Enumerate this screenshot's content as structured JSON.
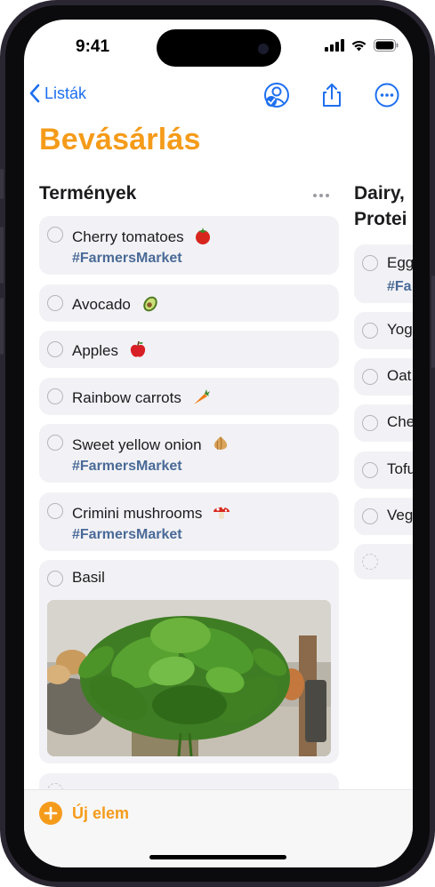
{
  "status_bar": {
    "time": "9:41"
  },
  "nav": {
    "back_label": "Listák"
  },
  "page": {
    "title": "Bevásárlás"
  },
  "columns": [
    {
      "header": "Termények",
      "items": [
        {
          "text": "Cherry tomatoes",
          "emoji": "tomato-icon",
          "tag": "#FarmersMarket"
        },
        {
          "text": "Avocado",
          "emoji": "avocado-icon",
          "tag": ""
        },
        {
          "text": "Apples",
          "emoji": "apple-icon",
          "tag": ""
        },
        {
          "text": "Rainbow carrots",
          "emoji": "carrot-icon",
          "tag": ""
        },
        {
          "text": "Sweet yellow onion",
          "emoji": "onion-icon",
          "tag": "#FarmersMarket"
        },
        {
          "text": "Crimini mushrooms",
          "emoji": "mushroom-icon",
          "tag": "#FarmersMarket"
        },
        {
          "text": "Basil",
          "emoji": "",
          "tag": "",
          "image": "basil-photo"
        }
      ]
    },
    {
      "header_line1": "Dairy,",
      "header_line2": "Protei",
      "items": [
        {
          "text": "Egg",
          "tag": "#Fa"
        },
        {
          "text": "Yog"
        },
        {
          "text": "Oat"
        },
        {
          "text": "Che"
        },
        {
          "text": "Tofu"
        },
        {
          "text": "Veg"
        }
      ]
    }
  ],
  "toolbar": {
    "new_item_label": "Új elem"
  },
  "colors": {
    "accent": "#f59b1a",
    "link": "#1e6ff0",
    "tag": "#4a6a97",
    "card": "#f2f2f6"
  }
}
